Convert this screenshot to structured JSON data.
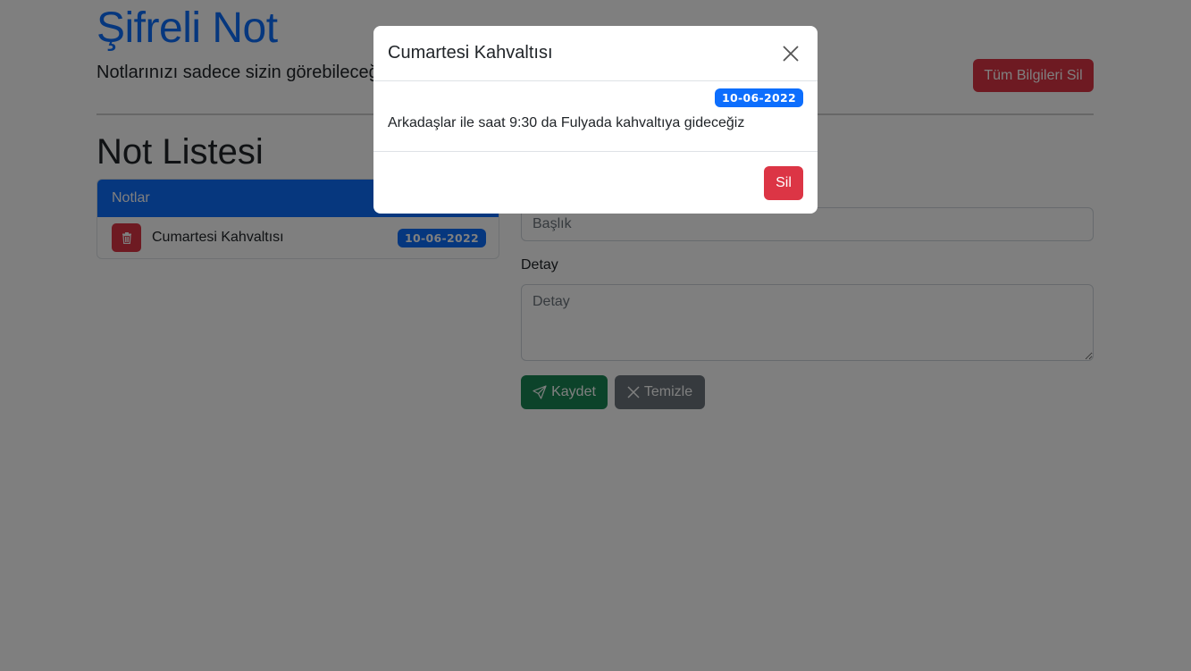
{
  "header": {
    "title": "Şifreli Not",
    "subtitle": "Notlarınızı sadece sizin görebileceğiniz",
    "clear_all_label": "Tüm Bilgileri Sil"
  },
  "notes_section": {
    "title": "Not Listesi",
    "card_header": "Notlar",
    "items": [
      {
        "title": "Cumartesi Kahvaltısı",
        "date": "10-06-2022"
      }
    ]
  },
  "form": {
    "title_placeholder": "Başlık",
    "detail_label": "Detay",
    "detail_placeholder": "Detay",
    "save_label": "Kaydet",
    "clear_label": "Temizle"
  },
  "modal": {
    "title": "Cumartesi Kahvaltısı",
    "date": "10-06-2022",
    "body": "Arkadaşlar ile saat 9:30 da Fulyada kahvaltıya gideceğiz",
    "delete_label": "Sil"
  },
  "icons": {
    "delete": "trash-icon",
    "save": "send-icon",
    "clear": "x-icon",
    "close": "close-icon"
  },
  "colors": {
    "primary": "#0d6efd",
    "danger": "#dc3545",
    "success": "#198754",
    "secondary": "#6c757d"
  }
}
